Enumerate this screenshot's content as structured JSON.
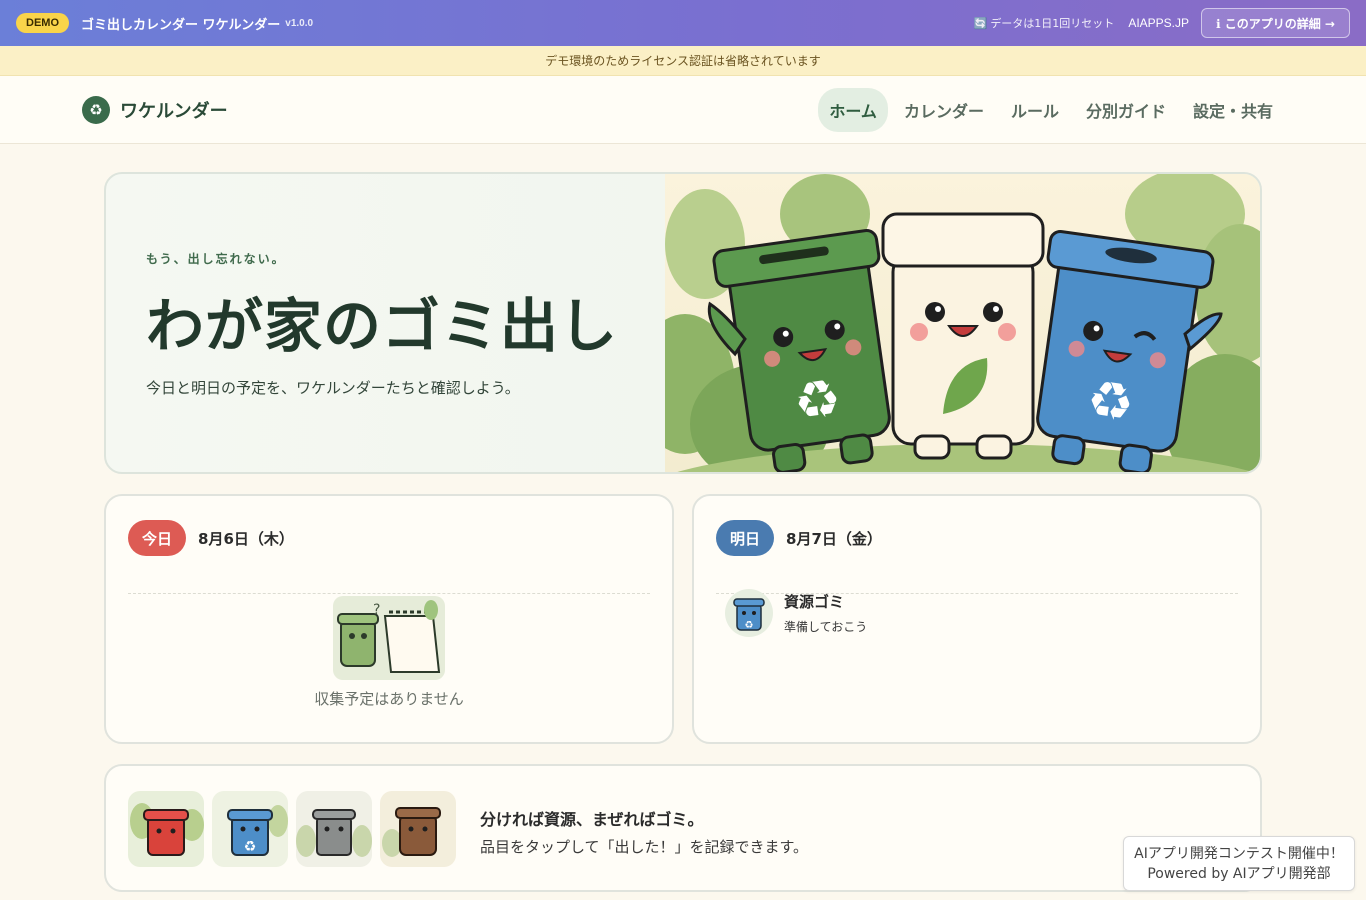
{
  "topbar": {
    "demo_label": "DEMO",
    "title": "ゴミ出しカレンダー ワケルンダー",
    "version": "v1.0.0",
    "reset_icon": "refresh-icon",
    "reset_note": "データは1日1回リセット",
    "site": "AIAPPS.JP",
    "detail_button": "ℹ このアプリの詳細 →"
  },
  "notice": "デモ環境のためライセンス認証は省略されています",
  "nav": {
    "brand": "ワケルンダー",
    "links": [
      "ホーム",
      "カレンダー",
      "ルール",
      "分別ガイド",
      "設定・共有"
    ],
    "active": "ホーム"
  },
  "hero": {
    "eyebrow": "もう、出し忘れない。",
    "title": "わが家のゴミ出し",
    "subtitle": "今日と明日の予定を、ワケルンダーたちと確認しよう。"
  },
  "today": {
    "label": "今日",
    "date": "8月6日（木）",
    "empty": "収集予定はありません"
  },
  "tomorrow": {
    "label": "明日",
    "date": "8月7日（金）",
    "item_name": "資源ゴミ",
    "item_note": "準備しておこう"
  },
  "bottom": {
    "title": "分ければ資源、まぜればゴミ。",
    "subtitle": "品目をタップして「出した！」を記録できます。"
  },
  "contest": {
    "line1": "AIアプリ開発コンテスト開催中！",
    "line2": "Powered by AIアプリ開発部"
  },
  "colors": {
    "brand_green": "#3a6b4b",
    "today_red": "#dd5b54",
    "tomorrow_blue": "#4a7bb0",
    "demo_yellow": "#f9d44a"
  }
}
